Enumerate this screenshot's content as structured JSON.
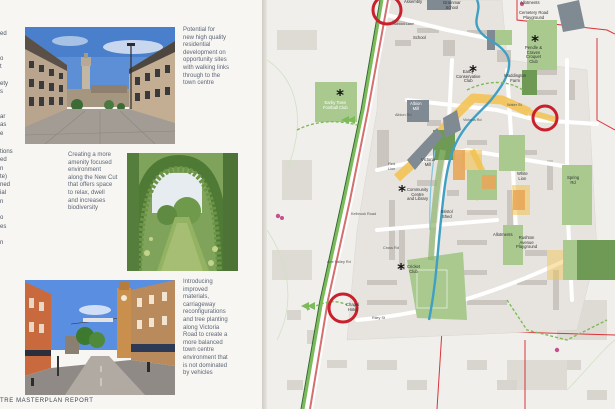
{
  "report": {
    "footer": "TRE MASTERPLAN REPORT"
  },
  "left_edge": {
    "block_a": [
      "ed",
      "",
      "",
      "o",
      "t",
      "",
      "ety",
      "s",
      "",
      "",
      "ar",
      "as",
      "e"
    ],
    "block_b": [
      "tions",
      "ed",
      "n",
      "te)",
      "ned",
      "ial",
      "n",
      "",
      "o",
      "es",
      "",
      "n"
    ]
  },
  "photos": [
    {
      "name": "residential-development-photo",
      "caption_lines": [
        "Potential for",
        "new high quality",
        "residential",
        "development on",
        "opportunity sites",
        "with walking links",
        "through to the",
        "town centre"
      ]
    },
    {
      "name": "green-corridor-photo",
      "caption_lines": [
        "Creating a more",
        "amenity focused",
        "environment",
        "along the New Cut",
        "that offers space",
        "to relax, dwell",
        "and increases",
        "biodiversity"
      ]
    },
    {
      "name": "victoria-road-photo",
      "caption_lines": [
        "Introducing",
        "improved",
        "materials,",
        "carriageway",
        "reconfigurations",
        "and tree planting",
        "along Victoria",
        "Road to create a",
        "more balanced",
        "town centre",
        "environment that",
        "is not dominated",
        "by vehicles"
      ]
    }
  ],
  "map": {
    "labels": {
      "assembly": "Assembly",
      "grammar_school": [
        "Grammar",
        "School"
      ],
      "school": "School",
      "school_lane": "School Lane",
      "allotments_top": "Allotments",
      "cemetery_road": [
        "Cemetery Road",
        "Playground"
      ],
      "pendle": [
        "Pendle &",
        "Craven",
        "Croquet",
        "Club"
      ],
      "earby_conservative": [
        "Earby",
        "Conservative",
        "Club"
      ],
      "waddington": [
        "Waddington",
        "Farm"
      ],
      "earby_town_fc": [
        "Earby Town",
        "Football Club"
      ],
      "albion_mill": [
        "Albion",
        "Mill"
      ],
      "albion_road": "Albion Rd",
      "water_st": "Water St",
      "victoria_mill": [
        "Victoria",
        "Mill"
      ],
      "community_centre": [
        "Community",
        "Centre",
        "and Library"
      ],
      "red_lion": [
        "Red",
        "Lion"
      ],
      "white_lion": [
        "White",
        "Lion"
      ],
      "spring_rd": [
        "Spring",
        "Rd"
      ],
      "bristol_shed": [
        "Bristol",
        "Shed"
      ],
      "allotments_mid": "Allotments",
      "rushton": [
        "Rushton",
        "Avenue",
        "Playground"
      ],
      "cricket_club": [
        "Cricket",
        "Club"
      ],
      "cross_road": "Cross Rd",
      "kelbrook_road": "Kelbrook Road",
      "victoria_road": "Victoria Rd",
      "chapel_hotel": [
        "Chapel",
        "Hotel"
      ],
      "riley_st": "Riley St",
      "aire_valley": "Aire Valley Rd"
    },
    "colors": {
      "road": "#ffffff",
      "building": "#c9c6c0",
      "green_space": "#a9c98f",
      "dark_green": "#6e9a56",
      "focus_yellow": "#f2c14e",
      "key_building": "#7f8a93",
      "water": "#3fa0c4",
      "boundary_red": "#d9343a",
      "greenway": "#8bb36b",
      "route_dashed": "#7dbb5a"
    }
  }
}
